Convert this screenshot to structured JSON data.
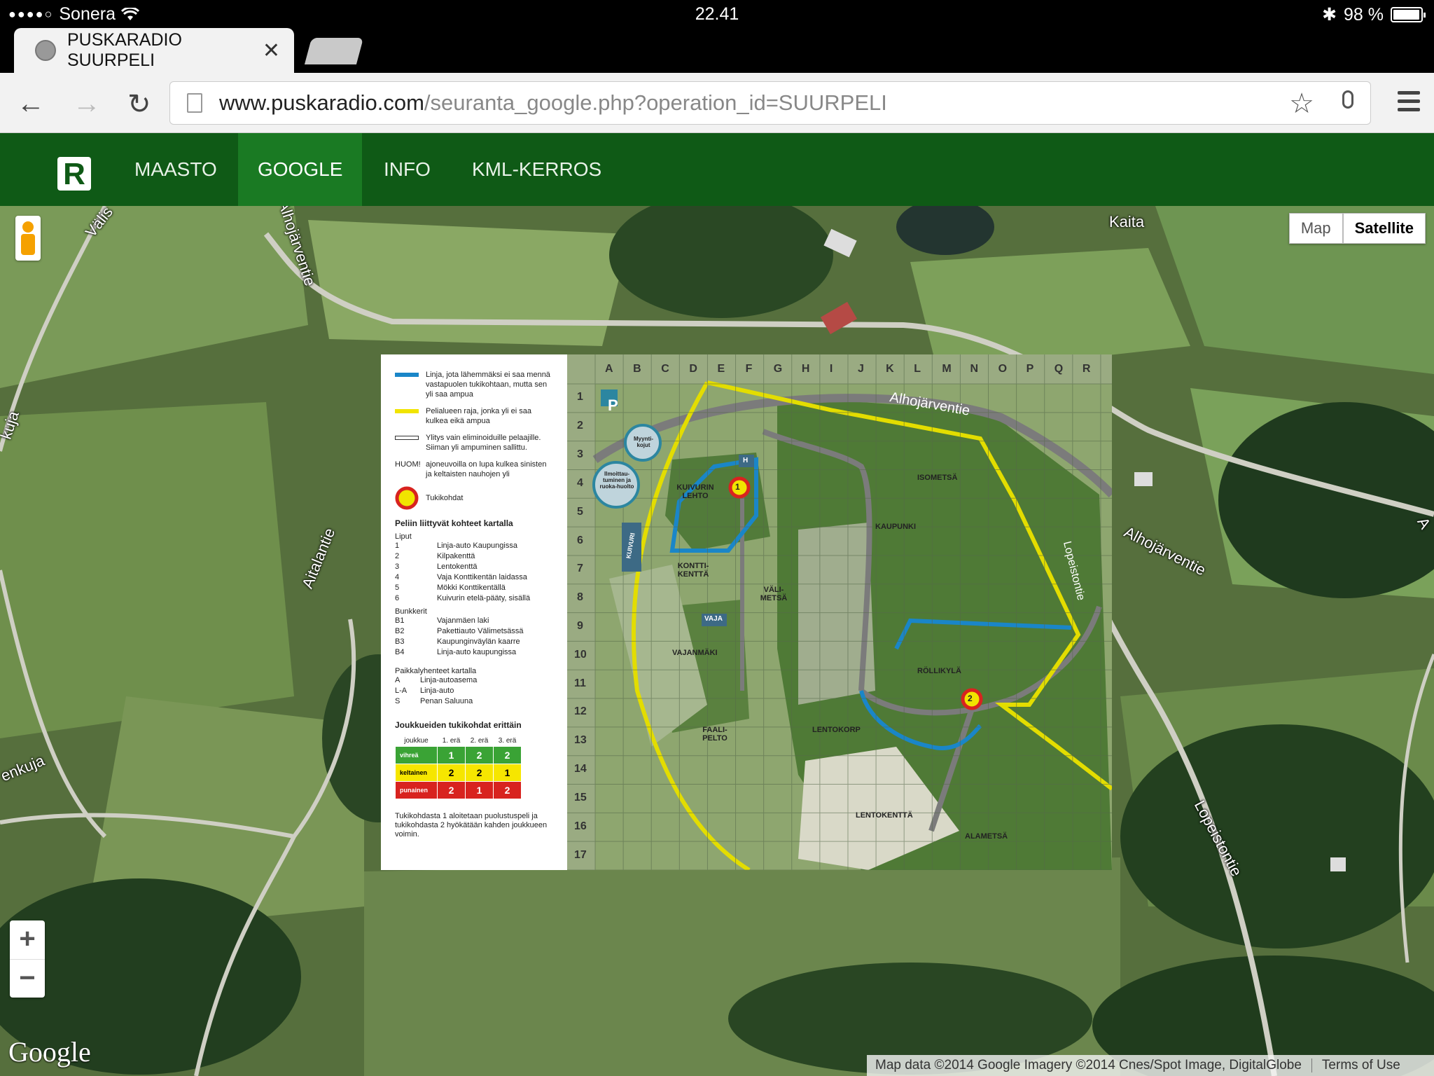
{
  "status_bar": {
    "carrier": "Sonera",
    "time": "22.41",
    "battery": "98 %",
    "battery_level": 0.98
  },
  "browser": {
    "tab_title": "PUSKARADIO SUURPELI",
    "url_host": "www.puskaradio.com",
    "url_path": "/seuranta_google.php?operation_id=SUURPELI"
  },
  "app_nav": {
    "logo": "R",
    "items": [
      {
        "label": "MAASTO"
      },
      {
        "label": "GOOGLE"
      },
      {
        "label": "INFO"
      },
      {
        "label": "KML-KERROS"
      }
    ],
    "active": "GOOGLE"
  },
  "map": {
    "type_map": "Map",
    "type_satellite": "Satellite",
    "selected_type": "Satellite",
    "zoom_in": "+",
    "zoom_out": "−",
    "google_logo": "Google",
    "attribution": "Map data ©2014 Google Imagery ©2014 Cnes/Spot Image, DigitalGlobe",
    "terms": "Terms of Use",
    "labels": {
      "kaita": "Kaita",
      "alhojarventie": "Alhojärventie",
      "lopeistontie": "Lopeistontie",
      "aitalantie": "Aitalantie",
      "alhojarventie_top": "Alhojärventie",
      "valis": "Välis",
      "enkuja": "enkuja",
      "kuja": "kuja",
      "a_edge": "A"
    }
  },
  "overlay": {
    "legend": {
      "line_blue": "Linja, jota lähemmäksi ei saa mennä vastapuolen tukikohtaan, mutta sen yli saa ampua",
      "line_yellow": "Pelialueen raja, jonka yli ei saa kulkea eikä ampua",
      "line_white": "Ylitys vain eliminoiduille pelaajille. Siiman yli ampuminen sallittu.",
      "huom_label": "HUOM!",
      "huom_text": "ajoneuvoilla on lupa kulkea sinisten ja keltaisten nauhojen yli",
      "tukikohdat": "Tukikohdat",
      "objects_title": "Peliin liittyvät kohteet kartalla",
      "flags_title": "Liput",
      "flags": [
        {
          "k": "1",
          "v": "Linja-auto Kaupungissa"
        },
        {
          "k": "2",
          "v": "Kilpakenttä"
        },
        {
          "k": "3",
          "v": "Lentokenttä"
        },
        {
          "k": "4",
          "v": "Vaja Konttikentän laidassa"
        },
        {
          "k": "5",
          "v": "Mökki Konttikentällä"
        },
        {
          "k": "6",
          "v": "Kuivurin etelä-pääty, sisällä"
        }
      ],
      "bunkers_title": "Bunkkerit",
      "bunkers": [
        {
          "k": "B1",
          "v": "Vajanmäen laki"
        },
        {
          "k": "B2",
          "v": "Pakettiauto Välimetsässä"
        },
        {
          "k": "B3",
          "v": "Kaupunginväylän kaarre"
        },
        {
          "k": "B4",
          "v": "Linja-auto kaupungissa"
        }
      ],
      "abbr_title": "Paikkalyhenteet kartalla",
      "abbr": [
        {
          "k": "A",
          "v": "Linja-autoasema"
        },
        {
          "k": "L-A",
          "v": "Linja-auto"
        },
        {
          "k": "S",
          "v": "Penan Saluuna"
        }
      ],
      "bases_title": "Joukkueiden tukikohdat erittäin",
      "table_headers": [
        "joukkue",
        "1. erä",
        "2. erä",
        "3. erä"
      ],
      "table_rows": [
        {
          "team": "vihreä",
          "vals": [
            "1",
            "2",
            "2"
          ],
          "color": "#3aa335"
        },
        {
          "team": "keltainen",
          "vals": [
            "2",
            "2",
            "1"
          ],
          "color": "#f6e600"
        },
        {
          "team": "punainen",
          "vals": [
            "2",
            "1",
            "2"
          ],
          "color": "#d8231f"
        }
      ],
      "footer": "Tukikohdasta 1 aloitetaan puolustuspeli ja tukikohdasta 2 hyökätään kahden joukkueen voimin."
    },
    "columns": [
      "A",
      "B",
      "C",
      "D",
      "E",
      "F",
      "G",
      "H",
      "I",
      "J",
      "K",
      "L",
      "M",
      "N",
      "O",
      "P",
      "Q",
      "R"
    ],
    "rows": [
      "1",
      "2",
      "3",
      "4",
      "5",
      "6",
      "7",
      "8",
      "9",
      "10",
      "11",
      "12",
      "13",
      "14",
      "15",
      "16",
      "17"
    ],
    "areas": {
      "kuivurin": "KUIVURIN LEHTO",
      "kontti": "KONTTI-KENTTÄ",
      "valimetsa": "VÄLI-METSÄ",
      "kaupunki": "KAUPUNKI",
      "isometsa": "ISOMETSÄ",
      "rollikyla": "RÖLLIKYLÄ",
      "vajanmaki": "VAJANMÄKI",
      "faalipelto": "FAALI-PELTO",
      "lentokorp": "LENTOKORP",
      "lentokentta": "LENTOKENTTÄ",
      "alametsa": "ALAMETSÄ",
      "myynti": "Myynti-kojut",
      "ilmoittau": "Ilmoittau-tuminen ja ruoka-huolto",
      "road": "Alhojärventie",
      "road2": "Lopeistontie",
      "parking": "P",
      "base1": "1",
      "base2": "2",
      "kuivuri": "KUIVURI",
      "vaja": "VAJA",
      "h": "H"
    }
  }
}
